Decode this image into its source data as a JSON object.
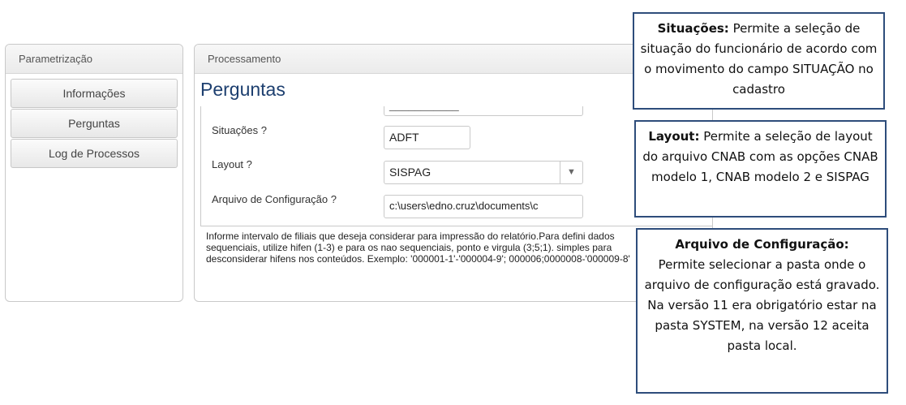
{
  "left_panel": {
    "title": "Parametrização",
    "buttons": [
      "Informações",
      "Perguntas",
      "Log de Processos"
    ]
  },
  "main_panel": {
    "title": "Processamento",
    "page_title": "Perguntas",
    "fields": {
      "top_cut_value": "___________",
      "situacoes": {
        "label": "Situações ?",
        "value": "ADFT"
      },
      "layout": {
        "label": "Layout ?",
        "value": "SISPAG"
      },
      "arquivo": {
        "label": "Arquivo de Configuração ?",
        "value": "c:\\users\\edno.cruz\\documents\\c"
      }
    },
    "help_text": "Informe intervalo de filiais que deseja considerar para impressão do relatório.Para defini dados sequenciais, utilize hifen (1-3) e para os nao sequenciais, ponto e virgula (3;5;1). simples para desconsiderar hifens nos conteúdos. Exemplo: '000001-1'-'000004-9'; 000006;0000008-'000009-8'"
  },
  "callouts": {
    "situacoes": {
      "heading": "Situações:",
      "text": " Permite a seleção de situação do funcionário de acordo com o movimento do campo SITUAÇÃO no cadastro"
    },
    "layout": {
      "heading": "Layout:",
      "text": " Permite a seleção de layout do arquivo CNAB com as opções CNAB modelo 1, CNAB modelo 2 e SISPAG"
    },
    "arquivo": {
      "heading": "Arquivo de Configuração:",
      "text": "Permite selecionar a pasta onde o arquivo de configuração está gravado. Na versão 11 era obrigatório estar na pasta SYSTEM, na versão 12 aceita pasta local."
    }
  },
  "icons": {
    "dropdown": "chevron-down-icon",
    "scroll_up": "triangle-up-icon"
  },
  "colors": {
    "title_blue": "#1d3f6f",
    "callout_border": "#2e4d7b"
  }
}
